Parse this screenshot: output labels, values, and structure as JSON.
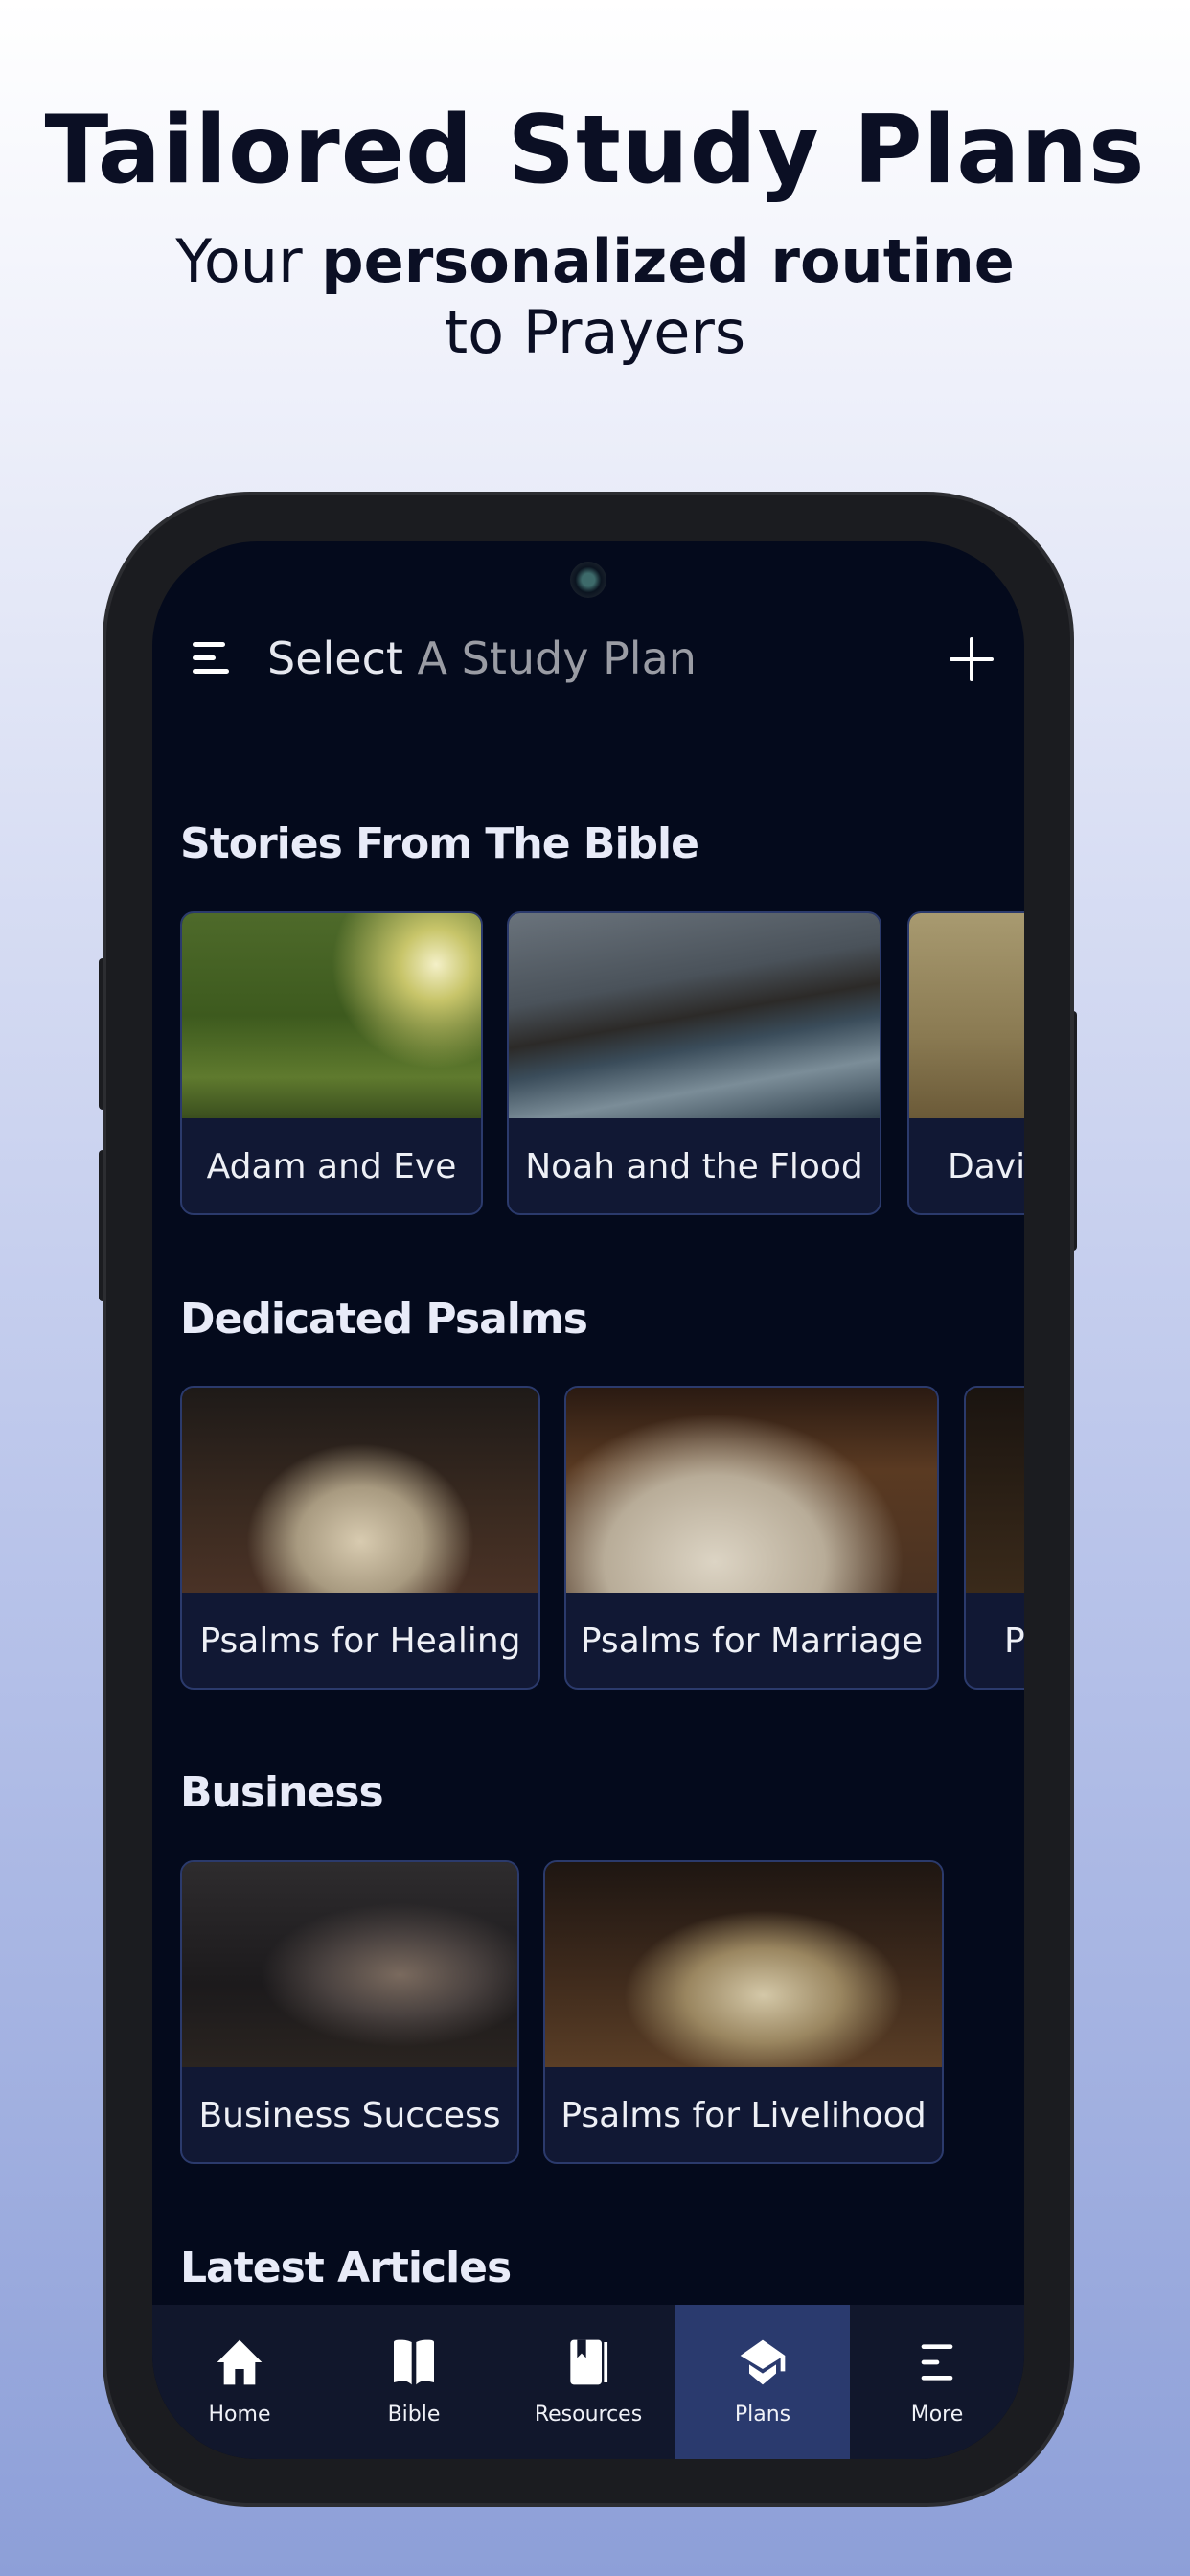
{
  "hero": {
    "title": "Tailored Study Plans",
    "subtitle_pre": "Your ",
    "subtitle_bold": "personalized routine",
    "subtitle_line2": "to Prayers"
  },
  "header": {
    "title_a": "Select",
    "title_b": " A Study Plan",
    "menu_icon": "hamburger-icon",
    "add_icon": "plus-icon"
  },
  "sections": [
    {
      "title": "Stories From The Bible",
      "cards": [
        {
          "label": "Adam and Eve"
        },
        {
          "label": "Noah and the Flood"
        },
        {
          "label": "David"
        }
      ]
    },
    {
      "title": "Dedicated Psalms",
      "cards": [
        {
          "label": "Psalms for Healing"
        },
        {
          "label": "Psalms for Marriage"
        },
        {
          "label": "Psalms"
        }
      ]
    },
    {
      "title": "Business",
      "cards": [
        {
          "label": "Business Success"
        },
        {
          "label": "Psalms for Livelihood"
        }
      ]
    },
    {
      "title": "Latest Articles"
    }
  ],
  "nav": {
    "active": "Plans",
    "items": [
      {
        "label": "Home",
        "icon": "home-icon"
      },
      {
        "label": "Bible",
        "icon": "bible-icon"
      },
      {
        "label": "Resources",
        "icon": "book-icon"
      },
      {
        "label": "Plans",
        "icon": "graduation-cap-icon"
      },
      {
        "label": "More",
        "icon": "menu-icon"
      }
    ]
  },
  "colors": {
    "screen_bg": "#040a1c",
    "card_bg": "#111834",
    "card_border": "#2b3a6c",
    "nav_bg": "#11172c",
    "nav_active": "#2a3a6e"
  }
}
